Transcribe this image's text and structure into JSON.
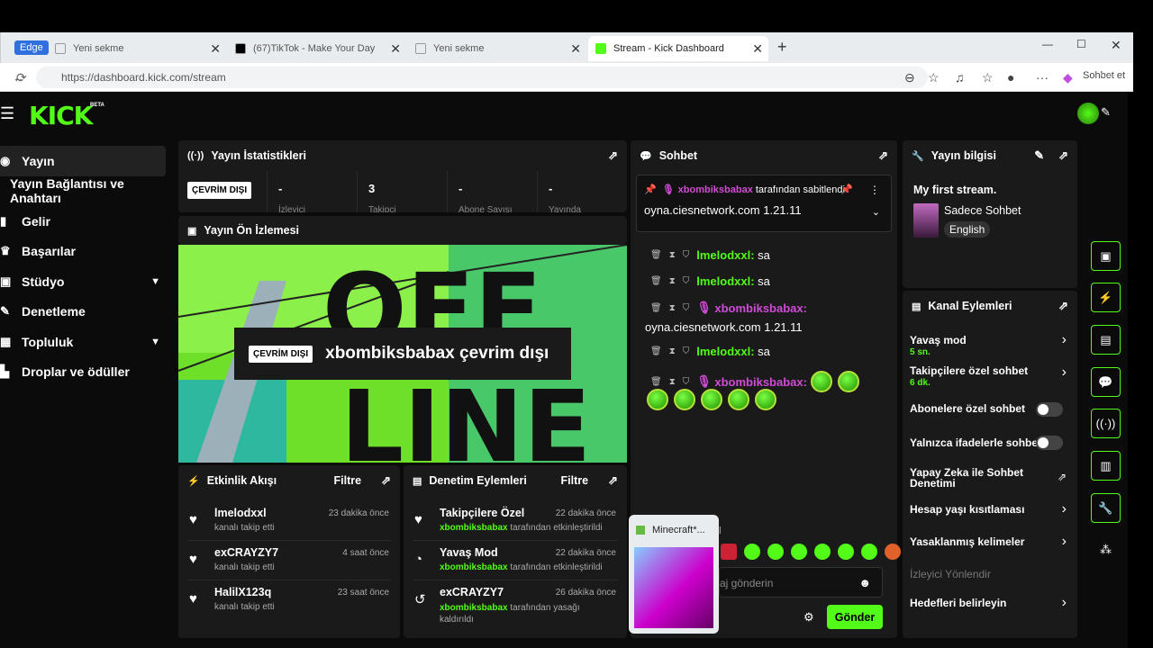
{
  "browser": {
    "edge_label": "Edge",
    "tabs": [
      {
        "label": "Yeni sekme"
      },
      {
        "label": "(67)TikTok - Make Your Day"
      },
      {
        "label": "Yeni sekme"
      },
      {
        "label": "Stream - Kick Dashboard"
      }
    ],
    "url": "https://dashboard.kick.com/stream",
    "copilot_label": "Sohbet et"
  },
  "header": {
    "logo": "KICK",
    "beta": "BETA"
  },
  "sidebar": {
    "items": [
      {
        "label": "Yayın"
      },
      {
        "label": "Yayın Bağlantısı ve Anahtarı"
      },
      {
        "label": "Gelir"
      },
      {
        "label": "Başarılar"
      },
      {
        "label": "Stüdyo"
      },
      {
        "label": "Denetleme"
      },
      {
        "label": "Topluluk"
      },
      {
        "label": "Droplar ve ödüller"
      }
    ]
  },
  "stats": {
    "title": "Yayın İstatistikleri",
    "status": "ÇEVRİM DIŞI",
    "values": [
      "-",
      "3",
      "-",
      "-"
    ],
    "labels": [
      "İzleyici",
      "Takipçi",
      "Abone Sayısı",
      "Yayında"
    ]
  },
  "preview": {
    "title": "Yayın Ön İzlemesi",
    "status": "ÇEVRİM DIŞI",
    "message": "xbombiksbabax çevrim dışı"
  },
  "activity": {
    "title": "Etkinlik Akışı",
    "filter": "Filtre",
    "items": [
      {
        "name": "lmelodxxl",
        "desc": "kanalı takip etti",
        "time": "23 dakika önce"
      },
      {
        "name": "exCRAYZY7",
        "desc": "kanalı takip etti",
        "time": "4 saat önce"
      },
      {
        "name": "HalilX123q",
        "desc": "kanalı takip etti",
        "time": "23 saat önce"
      }
    ]
  },
  "moderation": {
    "title": "Denetim Eylemleri",
    "filter": "Filtre",
    "items": [
      {
        "name": "Takipçilere Özel",
        "user": "xbombiksbabax",
        "desc": "tarafından etkinleştirildi",
        "time": "22 dakika önce"
      },
      {
        "name": "Yavaş Mod",
        "user": "xbombiksbabax",
        "desc": "tarafından etkinleştirildi",
        "time": "22 dakika önce"
      },
      {
        "name": "exCRAYZY7",
        "user": "xbombiksbabax",
        "desc": "tarafından yasağı kaldırıldı",
        "time": "26 dakika önce"
      }
    ]
  },
  "chat": {
    "title": "Sohbet",
    "pinned_user": "xbombiksbabax",
    "pinned_by": "tarafından sabitlendi",
    "pinned_msg": "oyna.ciesnetwork.com 1.21.11",
    "messages": [
      {
        "user": "lmelodxxl:",
        "text": "sa"
      },
      {
        "user": "lmelodxxl:",
        "text": "sa"
      },
      {
        "user": "xbombiksbabax:",
        "text": "oyna.ciesnetwork.com 1.21.11"
      },
      {
        "user": "lmelodxxl:",
        "text": "sa"
      },
      {
        "user": "xbombiksbabax:",
        "text": ""
      }
    ],
    "input_placeholder": "aj gönderin",
    "send_label": "Gönder",
    "partial_label": "el"
  },
  "stream_info": {
    "title": "Yayın bilgisi",
    "stream_title": "My first stream.",
    "category": "Sadece Sohbet",
    "language": "English"
  },
  "channel_actions": {
    "title": "Kanal Eylemleri",
    "items": [
      {
        "label": "Yavaş mod",
        "sub": "5 sn."
      },
      {
        "label": "Takipçilere özel sohbet",
        "sub": "6 dk."
      },
      {
        "label": "Abonelere özel sohbet",
        "sub": ""
      },
      {
        "label": "Yalnızca ifadelerle sohbet",
        "sub": ""
      },
      {
        "label": "Yapay Zeka ile Sohbet Denetimi",
        "sub": ""
      },
      {
        "label": "Hesap yaşı kısıtlaması",
        "sub": ""
      },
      {
        "label": "Yasaklanmış kelimeler",
        "sub": ""
      },
      {
        "label": "İzleyici Yönlendir",
        "sub": ""
      },
      {
        "label": "Hedefleri belirleyin",
        "sub": ""
      }
    ]
  },
  "popup": {
    "label": "Minecraft*..."
  }
}
